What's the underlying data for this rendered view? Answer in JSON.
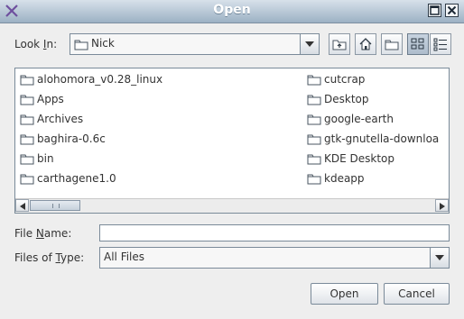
{
  "window": {
    "title": "Open",
    "icons": {
      "app": "x-logo-icon",
      "maximize": "maximize-icon",
      "close": "close-icon"
    }
  },
  "look_in": {
    "label_before": "Look ",
    "label_mnemonic": "I",
    "label_after": "n:",
    "value": "Nick",
    "value_icon": "folder-icon"
  },
  "toolbar": [
    {
      "name": "up-folder-button",
      "icon": "up-folder-icon"
    },
    {
      "name": "home-button",
      "icon": "home-icon"
    },
    {
      "name": "new-folder-button",
      "icon": "new-folder-icon"
    },
    {
      "name": "list-view-button",
      "icon": "list-view-icon",
      "active": true
    },
    {
      "name": "details-view-button",
      "icon": "details-view-icon"
    }
  ],
  "files": {
    "left": [
      "alohomora_v0.28_linux",
      "Apps",
      "Archives",
      "baghira-0.6c",
      "bin",
      "carthagene1.0"
    ],
    "right": [
      "cutcrap",
      "Desktop",
      "google-earth",
      "gtk-gnutella-downloa",
      "KDE Desktop",
      "kdeapp"
    ]
  },
  "file_name": {
    "label_before": "File ",
    "label_mnemonic": "N",
    "label_after": "ame:",
    "value": ""
  },
  "file_type": {
    "label_before": "Files of ",
    "label_mnemonic": "T",
    "label_after": "ype:",
    "value": "All Files"
  },
  "buttons": {
    "open": "Open",
    "cancel": "Cancel"
  }
}
